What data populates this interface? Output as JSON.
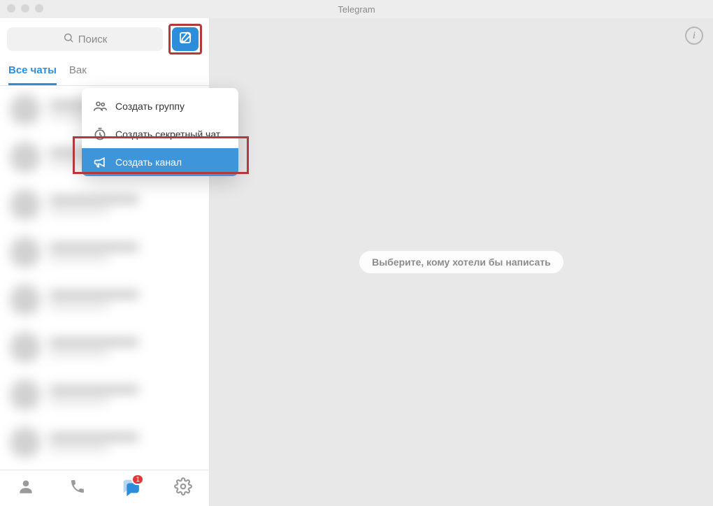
{
  "window": {
    "title": "Telegram"
  },
  "search": {
    "placeholder": "Поиск"
  },
  "tabs": {
    "all": "Все чаты",
    "important": "Вак"
  },
  "menu": {
    "group": "Создать группу",
    "secret": "Создать секретный чат",
    "channel": "Создать канал"
  },
  "main": {
    "hint": "Выберите, кому хотели бы написать"
  },
  "info_glyph": "i",
  "bottom": {
    "chats_badge": "1"
  }
}
